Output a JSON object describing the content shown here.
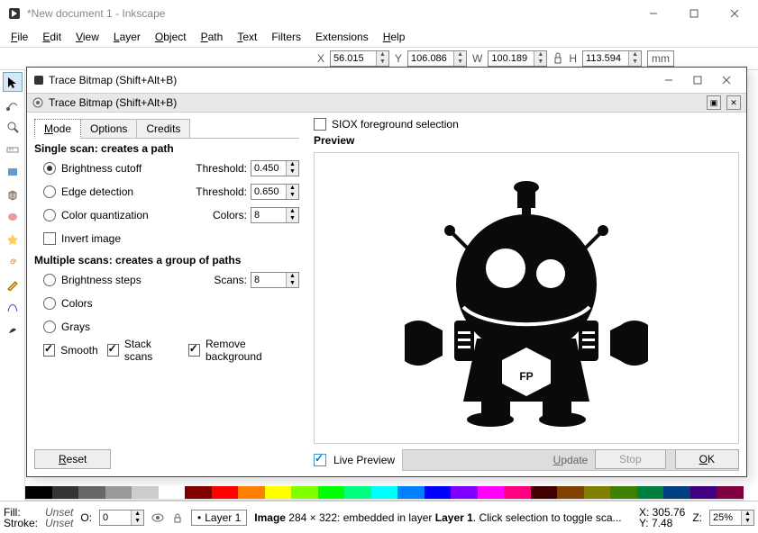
{
  "main": {
    "title": "*New document 1 - Inkscape",
    "menus": [
      "File",
      "Edit",
      "View",
      "Layer",
      "Object",
      "Path",
      "Text",
      "Filters",
      "Extensions",
      "Help"
    ],
    "coords": {
      "X_label": "X",
      "X_value": "56.015",
      "Y_label": "Y",
      "Y_value": "106.086",
      "W_label": "W",
      "W_value": "100.189",
      "H_label": "H",
      "H_value": "113.594",
      "unit": "mm"
    }
  },
  "dialog": {
    "title": "Trace Bitmap (Shift+Alt+B)",
    "subtitle": "Trace Bitmap (Shift+Alt+B)",
    "tabs": {
      "mode": "Mode",
      "options": "Options",
      "credits": "Credits"
    },
    "single_head": "Single scan: creates a path",
    "brightness": {
      "label": "Brightness cutoff",
      "param": "Threshold:",
      "value": "0.450"
    },
    "edge": {
      "label": "Edge detection",
      "param": "Threshold:",
      "value": "0.650"
    },
    "quant": {
      "label": "Color quantization",
      "param": "Colors:",
      "value": "8"
    },
    "invert": "Invert image",
    "multi_head": "Multiple scans: creates a group of paths",
    "steps": {
      "label": "Brightness steps",
      "param": "Scans:",
      "value": "8"
    },
    "colors_label": "Colors",
    "grays_label": "Grays",
    "smooth": "Smooth",
    "stack": "Stack scans",
    "removebg": "Remove background",
    "reset": "Reset",
    "siox": "SIOX foreground selection",
    "preview_label": "Preview",
    "preview_text": "FP",
    "live_preview": "Live Preview",
    "update": "Update",
    "stop": "Stop",
    "ok": "OK"
  },
  "status": {
    "fill_label": "Fill:",
    "fill_value": "Unset",
    "stroke_label": "Stroke:",
    "stroke_value": "Unset",
    "opacity_label": "O:",
    "opacity_value": "0",
    "layer": "Layer 1",
    "image_info": "Image 284 × 322: embedded in layer Layer 1. Click selection to toggle sca...",
    "X_label": "X:",
    "X_value": "305.76",
    "Y_label": "Y:",
    "Y_value": "7.48",
    "Z_label": "Z:",
    "Z_value": "25%"
  },
  "palette": [
    "#000",
    "#333",
    "#666",
    "#999",
    "#ccc",
    "#fff",
    "#800000",
    "#f00",
    "#ff8000",
    "#ff0",
    "#80ff00",
    "#0f0",
    "#00ff80",
    "#0ff",
    "#0080ff",
    "#00f",
    "#8000ff",
    "#f0f",
    "#ff0080",
    "#400000",
    "#804000",
    "#808000",
    "#408000",
    "#008040",
    "#004080",
    "#400080",
    "#800040"
  ]
}
